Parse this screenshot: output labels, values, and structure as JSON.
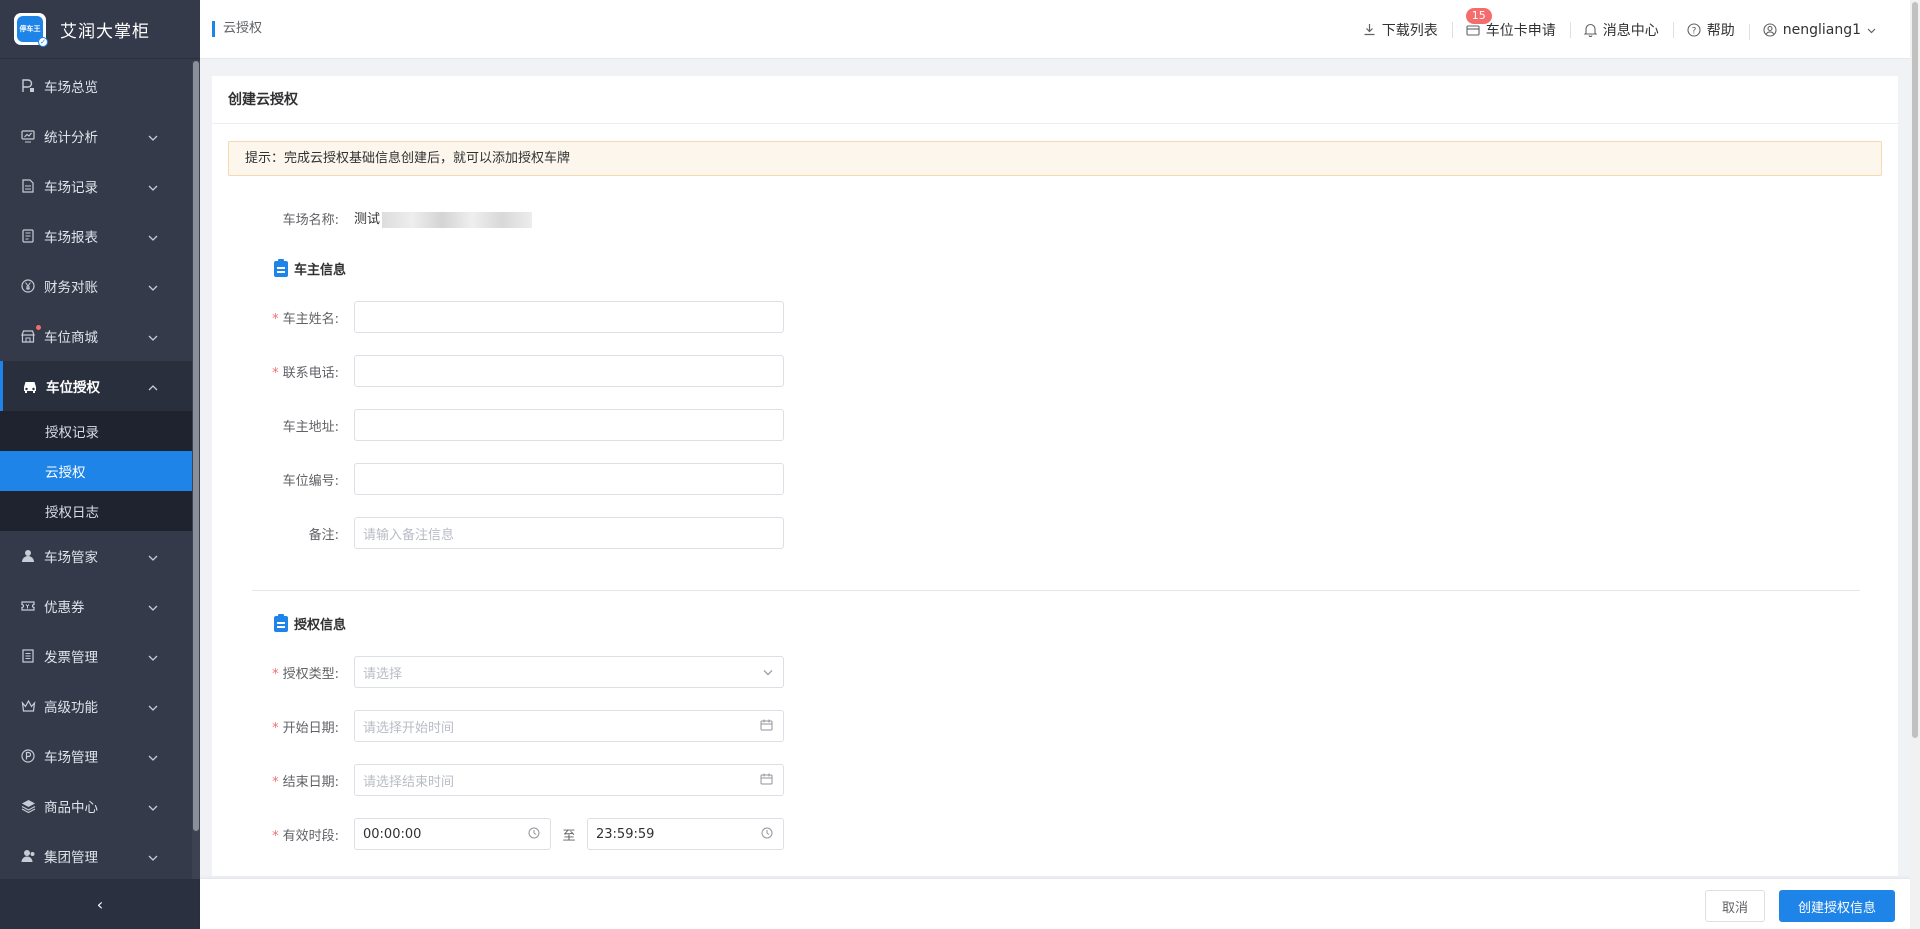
{
  "app": {
    "name": "艾润大掌柜",
    "logo_text": "停车王"
  },
  "sidebar": {
    "items": [
      {
        "label": "车场总览",
        "icon": "parking-icon",
        "has_chevron": false
      },
      {
        "label": "统计分析",
        "icon": "chart-icon",
        "has_chevron": true
      },
      {
        "label": "车场记录",
        "icon": "document-icon",
        "has_chevron": true
      },
      {
        "label": "车场报表",
        "icon": "report-icon",
        "has_chevron": true
      },
      {
        "label": "财务对账",
        "icon": "yen-icon",
        "has_chevron": true
      },
      {
        "label": "车位商城",
        "icon": "store-icon",
        "has_chevron": true,
        "dot": true
      },
      {
        "label": "车位授权",
        "icon": "car-icon",
        "has_chevron": true,
        "open": true,
        "children": [
          {
            "label": "授权记录"
          },
          {
            "label": "云授权",
            "active": true
          },
          {
            "label": "授权日志"
          }
        ]
      },
      {
        "label": "车场管家",
        "icon": "user-icon",
        "has_chevron": true
      },
      {
        "label": "优惠券",
        "icon": "ticket-icon",
        "has_chevron": true
      },
      {
        "label": "发票管理",
        "icon": "invoice-icon",
        "has_chevron": true
      },
      {
        "label": "高级功能",
        "icon": "crown-icon",
        "has_chevron": true
      },
      {
        "label": "车场管理",
        "icon": "p-circle-icon",
        "has_chevron": true
      },
      {
        "label": "商品中心",
        "icon": "layers-icon",
        "has_chevron": true
      },
      {
        "label": "集团管理",
        "icon": "group-icon",
        "has_chevron": true
      }
    ],
    "collapse_glyph": "‹"
  },
  "header": {
    "breadcrumb": "云授权",
    "actions": {
      "download": "下载列表",
      "card_apply": "车位卡申请",
      "card_apply_badge": "15",
      "messages": "消息中心",
      "help": "帮助",
      "user": "nengliang1"
    }
  },
  "card": {
    "title": "创建云授权",
    "tip": "提示：完成云授权基础信息创建后，就可以添加授权车牌"
  },
  "form": {
    "park_name_label": "车场名称:",
    "park_name_value": "测试",
    "owner_section": "车主信息",
    "owner_name_label": "车主姓名:",
    "owner_name_value": "",
    "phone_label": "联系电话:",
    "phone_value": "",
    "address_label": "车主地址:",
    "address_value": "",
    "space_no_label": "车位编号:",
    "space_no_value": "",
    "remark_label": "备注:",
    "remark_placeholder": "请输入备注信息",
    "auth_section": "授权信息",
    "auth_type_label": "授权类型:",
    "auth_type_placeholder": "请选择",
    "start_date_label": "开始日期:",
    "start_date_placeholder": "请选择开始时间",
    "end_date_label": "结束日期:",
    "end_date_placeholder": "请选择结束时间",
    "period_label": "有效时段:",
    "period_start": "00:00:00",
    "period_sep": "至",
    "period_end": "23:59:59"
  },
  "footer": {
    "cancel": "取消",
    "submit": "创建授权信息"
  },
  "colors": {
    "primary": "#1e84e8",
    "sidebar_bg": "#343a4a",
    "required": "#f56c6c",
    "tip_bg": "#fdf6ec"
  }
}
